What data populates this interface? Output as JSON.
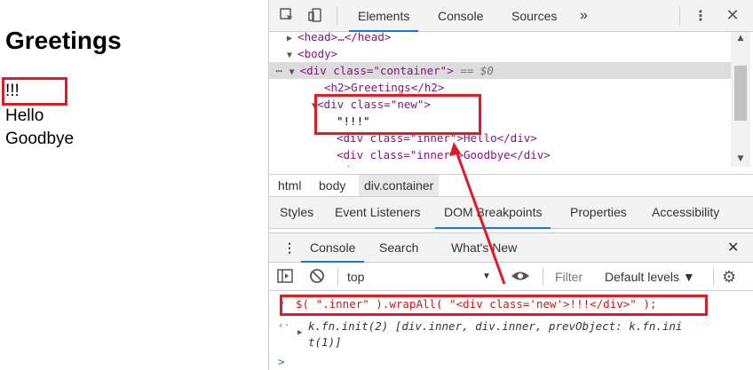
{
  "page": {
    "heading": "Greetings",
    "lines": [
      "!!!",
      "Hello",
      "Goodbye"
    ]
  },
  "devtools": {
    "tabs": [
      "Elements",
      "Console",
      "Sources"
    ],
    "active_tab": "Elements",
    "more_tabs": "»",
    "dom": {
      "head": "<head>…</head>",
      "body": "<body>",
      "container_open": "<div class=\"container\">",
      "container_suffix": " == $0",
      "h2": "<h2>Greetings</h2>",
      "new_div": "<div class=\"new\">",
      "new_text": "\"!!!\"",
      "inner1": "<div class=\"inner\">Hello</div>",
      "inner2": "<div class=\"inner\">Goodbye</div>",
      "partial": "</"
    },
    "breadcrumbs": [
      "html",
      "body",
      "div.container"
    ],
    "sidebar_tabs": [
      "Styles",
      "Event Listeners",
      "DOM Breakpoints",
      "Properties",
      "Accessibility"
    ],
    "drawer_tabs": [
      "Console",
      "Search",
      "What's New"
    ],
    "context": "top",
    "filter_placeholder": "Filter",
    "levels": "Default levels ▼",
    "console": {
      "command": "$( \".inner\" ).wrapAll( \"<div class='new'>!!!</div>\" );",
      "result_line1": "k.fn.init(2) [div.inner, div.inner, prevObject: k.fn.ini",
      "result_line2": "t(1)]",
      "prompt": ">"
    }
  },
  "colors": {
    "accent": "#1a73e8",
    "annotation": "#e01b24"
  }
}
